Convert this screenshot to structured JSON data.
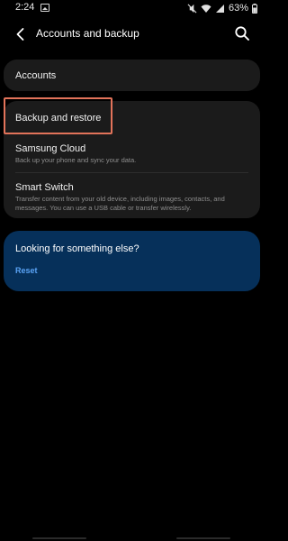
{
  "status_bar": {
    "time": "2:24",
    "battery": "63%"
  },
  "header": {
    "title": "Accounts and backup"
  },
  "sections": {
    "accounts": {
      "title": "Accounts"
    },
    "backup": {
      "items": [
        {
          "title": "Backup and restore",
          "subtitle": ""
        },
        {
          "title": "Samsung Cloud",
          "subtitle": "Back up your phone and sync your data."
        },
        {
          "title": "Smart Switch",
          "subtitle": "Transfer content from your old device, including images, contacts, and messages. You can use a USB cable or transfer wirelessly."
        }
      ]
    }
  },
  "suggestion": {
    "title": "Looking for something else?",
    "link": "Reset"
  },
  "colors": {
    "background": "#000000",
    "card": "#1b1b1b",
    "suggestion_card": "#06305a",
    "link": "#5aa3f5",
    "highlight": "#e2735a"
  },
  "icons": {
    "back": "chevron-left-icon",
    "search": "search-icon",
    "image": "image-icon",
    "mute": "mute-icon",
    "wifi": "wifi-icon",
    "signal": "signal-icon",
    "battery": "battery-icon"
  }
}
